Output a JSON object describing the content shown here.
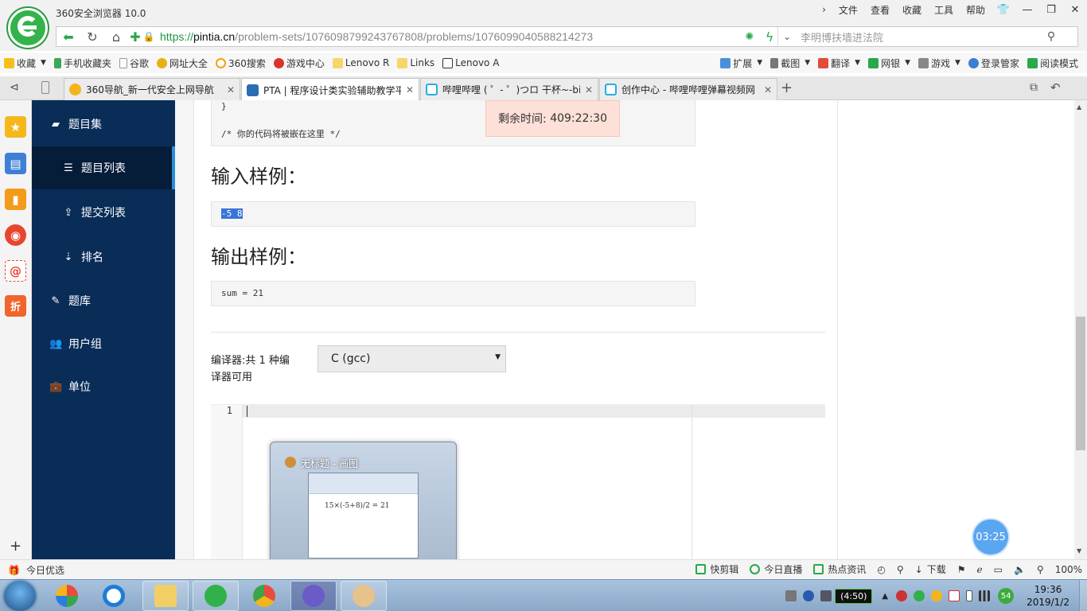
{
  "browser": {
    "app_title": "360安全浏览器 10.0",
    "menus": [
      "文件",
      "查看",
      "收藏",
      "工具",
      "帮助"
    ],
    "url_scheme": "https://",
    "url_host": "pintia.cn",
    "url_path": "/problem-sets/1076098799243767808/problems/1076099040588214273",
    "search_placeholder": "李明博扶墙进法院",
    "bookmarks": [
      "收藏",
      "手机收藏夹",
      "谷歌",
      "网址大全",
      "360搜索",
      "游戏中心",
      "Lenovo R",
      "Links",
      "Lenovo A"
    ],
    "bm_tools": [
      "扩展",
      "截图",
      "翻译",
      "网银",
      "游戏",
      "登录管家",
      "阅读模式"
    ],
    "tabs": [
      {
        "label": "360导航_新一代安全上网导航",
        "color": "#f3b51b"
      },
      {
        "label": "PTA | 程序设计类实验辅助教学平",
        "color": "#2a6db5"
      },
      {
        "label": "哔哩哔哩 ( ゜- ゜)つロ 干杯~-bili",
        "color": "#23ade5"
      },
      {
        "label": "创作中心 - 哔哩哔哩弹幕视频网",
        "color": "#23ade5"
      }
    ]
  },
  "nav": {
    "problem_sets": "题目集",
    "problem_list": "题目列表",
    "submissions": "提交列表",
    "ranking": "排名",
    "problem_bank": "题库",
    "user_groups": "用户组",
    "units": "单位"
  },
  "main": {
    "code_tail_brace": "}",
    "code_tail_comment": "/* 你的代码将被嵌在这里 */",
    "timer_label": "剩余时间:",
    "timer_value": "409:22:30",
    "input_title": "输入样例：",
    "input_sample": "-5 8",
    "output_title": "输出样例：",
    "output_sample": "sum = 21",
    "compiler_label": "编译器:共 1 种编译器可用",
    "compiler_selected": "C (gcc)",
    "editor_line": "1"
  },
  "overlay": {
    "clock_bubble": "03:25",
    "preview_title": "无标题 - 画图",
    "preview_scribble": "15×(-5+8)/2 = 21"
  },
  "statusbar": {
    "left": "今日优选",
    "items": [
      "快剪辑",
      "今日直播",
      "热点资讯",
      "下载"
    ],
    "zoom": "100%"
  },
  "taskbar": {
    "battery": "(4:50)",
    "badge": "54",
    "time": "19:36",
    "date": "2019/1/2"
  }
}
